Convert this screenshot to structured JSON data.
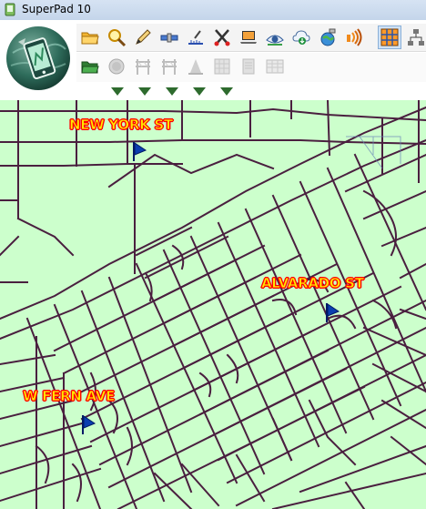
{
  "window": {
    "title": "SuperPad 10",
    "app_icon": "superpad-app-icon"
  },
  "toolbar": {
    "logo": "superpad-globe-phone-logo",
    "row1_icons": [
      "open-folder-icon",
      "magnifier-icon",
      "pen-icon",
      "satellite-icon",
      "measure-icon",
      "scissors-icon",
      "laptop-icon",
      "eye-icon",
      "cloud-download-icon",
      "globe-satellite-icon",
      "signal-icon",
      "grid-table-icon",
      "network-icon"
    ],
    "row2_icons": [
      "folder-green-icon",
      "circle-icon",
      "barricade-icon",
      "barricade-icon",
      "cone-icon",
      "grid-icon",
      "document-icon",
      "table-icon"
    ],
    "dropdown_arrow_count": 5,
    "active_icon": "grid-table-icon"
  },
  "map": {
    "background_color": "#ccffcc",
    "street_color": "#4a1f3f",
    "labels": [
      {
        "text": "NEW YORK ST"
      },
      {
        "text": "ALVARADO ST"
      },
      {
        "text": "W FERN AVE"
      }
    ],
    "marker_icon": "blue-flag-icon"
  }
}
